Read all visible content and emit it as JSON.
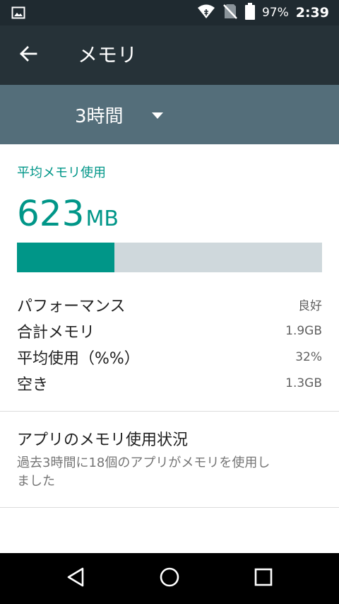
{
  "status_bar": {
    "battery_percent": "97%",
    "time": "2:39",
    "icons": [
      "image-icon",
      "wifi-icon",
      "no-sim-icon",
      "battery-icon"
    ]
  },
  "app_bar": {
    "title": "メモリ",
    "back_icon": "arrow-left-icon"
  },
  "filter": {
    "selected_period": "3時間",
    "dropdown_icon": "dropdown-triangle-icon"
  },
  "memory": {
    "section_label": "平均メモリ使用",
    "value": "623",
    "unit": "MB",
    "usage_fraction": 0.32,
    "stats": [
      {
        "label": "パフォーマンス",
        "value": "良好"
      },
      {
        "label": "合計メモリ",
        "value": "1.9GB"
      },
      {
        "label": "平均使用（%%）",
        "value": "32%"
      },
      {
        "label": "空き",
        "value": "1.3GB"
      }
    ]
  },
  "app_usage": {
    "title": "アプリのメモリ使用状況",
    "summary_line1": "過去3時間に18個のアプリがメモリを使用し",
    "summary_line2": "ました"
  },
  "colors": {
    "accent": "#009688",
    "app_bar": "#263238",
    "filter_bar": "#546e7a",
    "status_bar": "#1f2a30",
    "bar_track": "#cfd8dc"
  },
  "nav": {
    "back_icon": "nav-back-triangle-icon",
    "home_icon": "nav-home-circle-icon",
    "recents_icon": "nav-recents-square-icon"
  }
}
